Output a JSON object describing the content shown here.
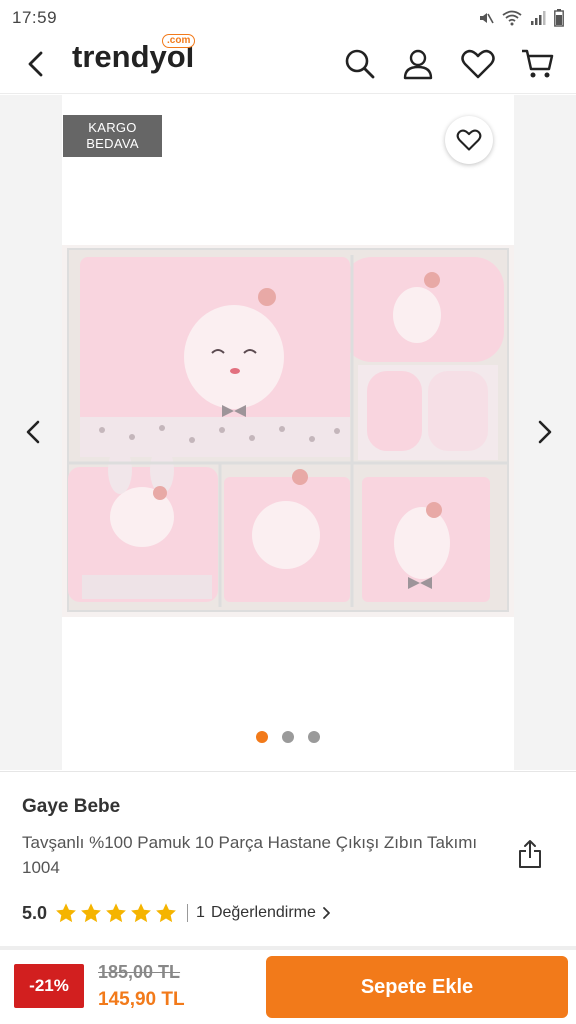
{
  "status_bar": {
    "time": "17:59",
    "icons": [
      "mute-icon",
      "wifi-icon",
      "signal-icon",
      "battery-icon"
    ]
  },
  "header": {
    "logo_text": "trendyol",
    "logo_suffix": ".com",
    "icons": [
      "back-arrow-icon",
      "search-icon",
      "user-icon",
      "heart-icon",
      "cart-icon"
    ]
  },
  "gallery": {
    "badge_line1": "KARGO",
    "badge_line2": "BEDAVA",
    "current_image": 1,
    "image_count": 3
  },
  "product": {
    "brand": "Gaye Bebe",
    "name": "Tavşanlı %100 Pamuk 10 Parça Hastane Çıkışı Zıbın Takımı 1004",
    "rating": "5.0",
    "stars": 5,
    "review_count": "1",
    "review_label": "Değerlendirme"
  },
  "pricing": {
    "discount": "-21%",
    "old_price": "185,00 TL",
    "new_price": "145,90 TL"
  },
  "actions": {
    "add_to_cart": "Sepete Ekle"
  },
  "colors": {
    "brand_orange": "#f27a1a",
    "discount_red": "#d21f1f",
    "star_yellow": "#f5b400",
    "product_pink": "#f9d5df"
  }
}
